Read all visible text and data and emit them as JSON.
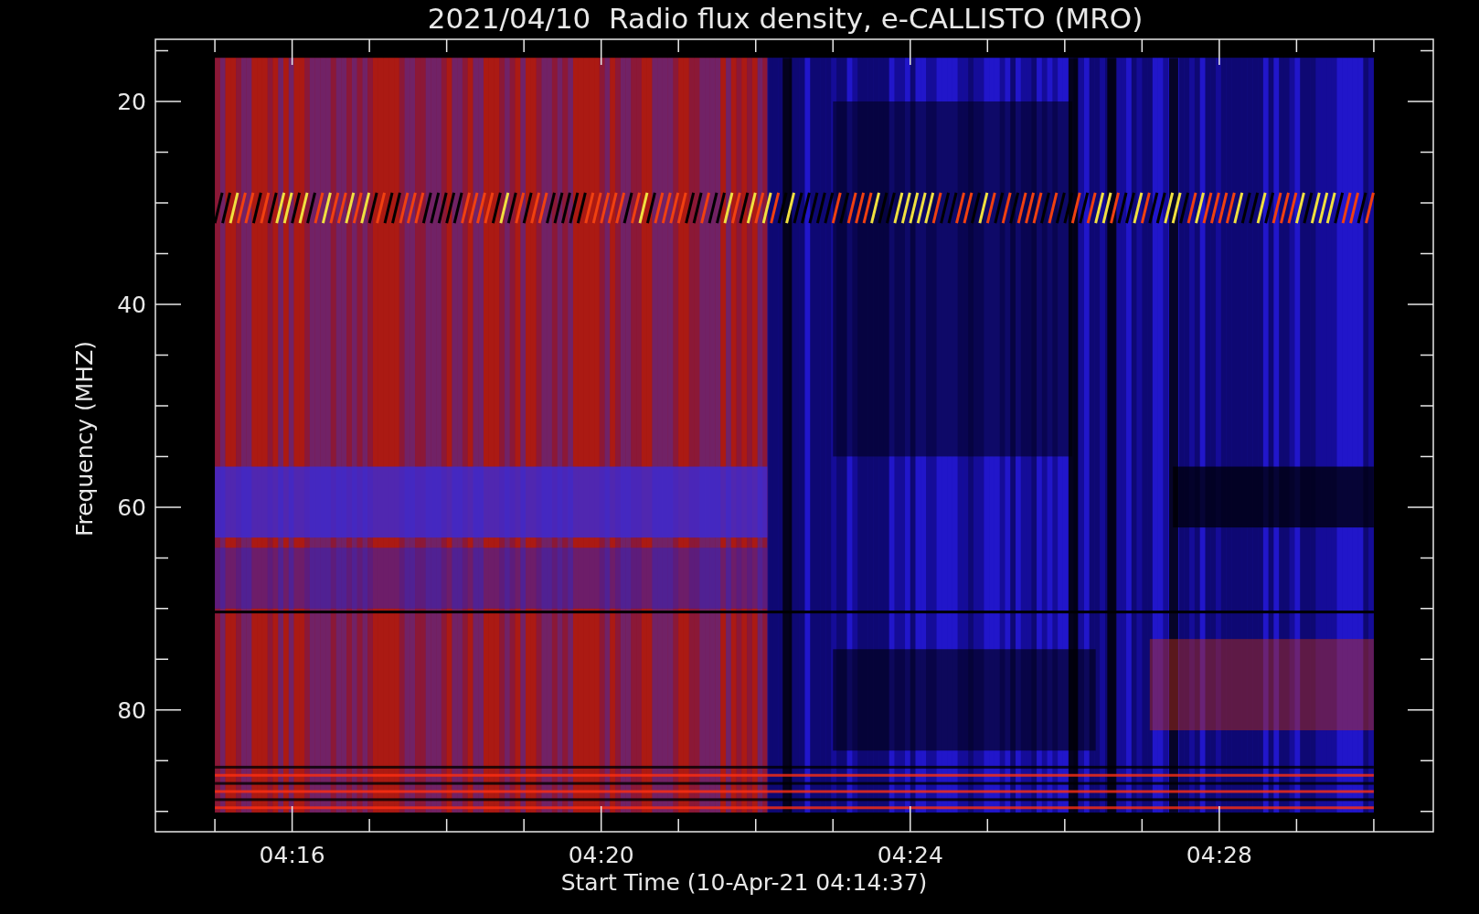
{
  "plot": {
    "title": "2021/04/10  Radio flux density, e-CALLISTO (MRO)",
    "xlabel": "Start Time (10-Apr-21 04:14:37)",
    "ylabel": "Frequency (MHZ)",
    "xticks": [
      "04:16",
      "04:20",
      "04:24",
      "04:28"
    ],
    "yticks": [
      "20",
      "40",
      "60",
      "80"
    ]
  }
}
